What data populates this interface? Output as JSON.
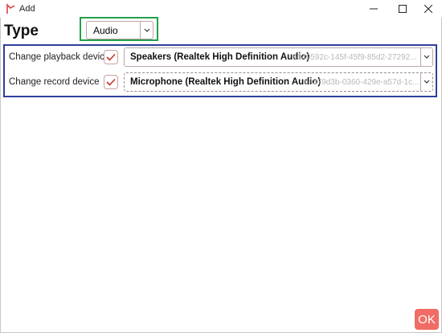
{
  "window": {
    "title": "Add",
    "accent": "#e04040"
  },
  "type": {
    "label": "Type",
    "selected": "Audio"
  },
  "devices": [
    {
      "label": "Change playback device",
      "checked": true,
      "name": "Speakers (Realtek High Definition Audio)",
      "id": "4149592c-145f-45f9-85d2-27292..."
    },
    {
      "label": "Change record device",
      "checked": true,
      "name": "Microphone (Realtek High Definition Audio)",
      "id": "de379d3b-0360-429e-a57d-1c..."
    }
  ],
  "footer": {
    "ok_label": "OK"
  },
  "colors": {
    "type_highlight": "#22a04a",
    "devices_highlight": "#2f3f9c",
    "ok_button": "#f06c64",
    "checkmark": "#c0392b"
  }
}
